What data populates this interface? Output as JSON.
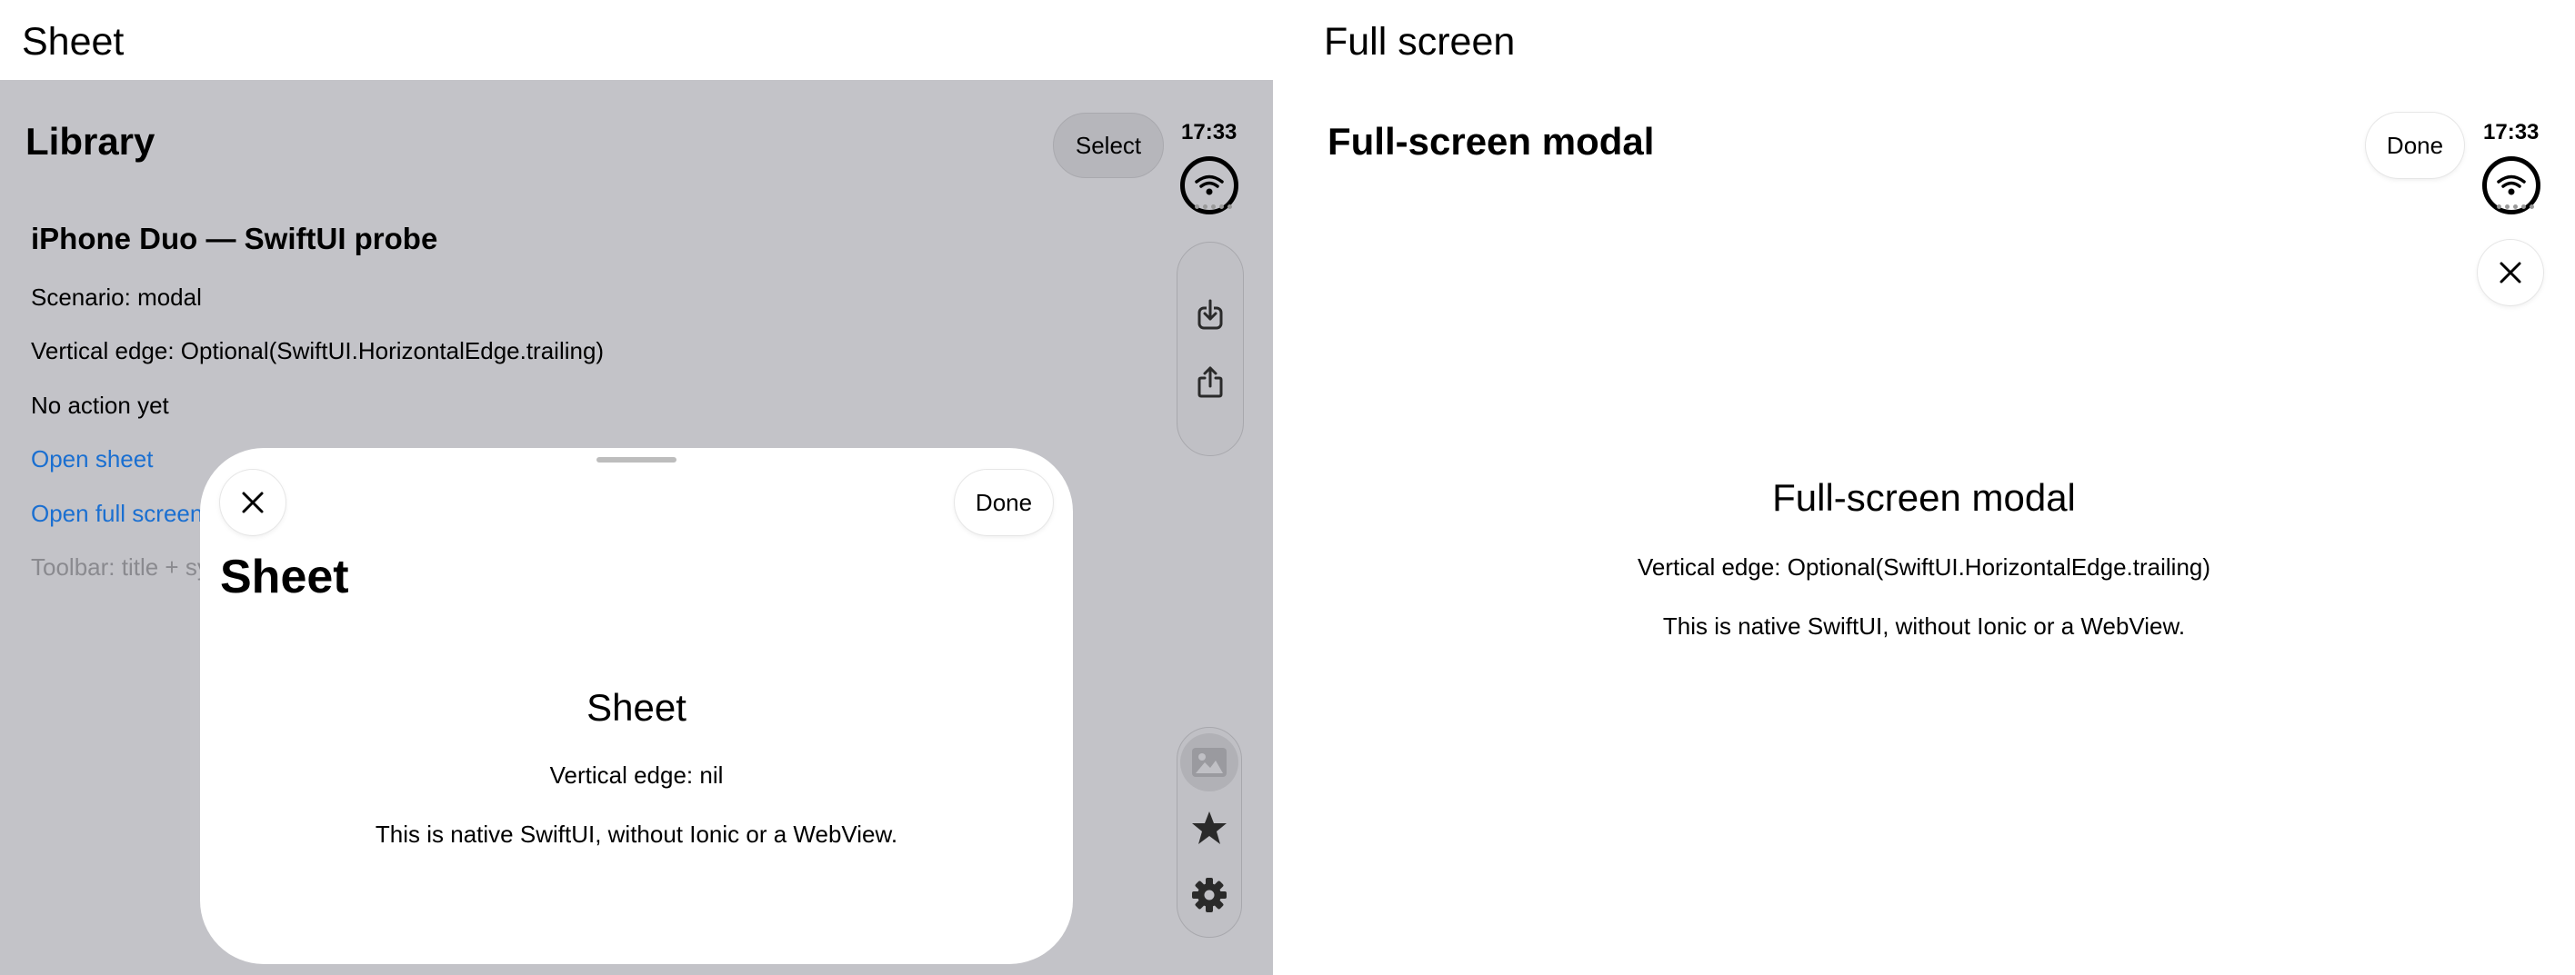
{
  "captions": {
    "left": "Sheet",
    "right": "Full screen"
  },
  "status": {
    "time": "17:33"
  },
  "library": {
    "title": "Library",
    "select_label": "Select",
    "probe": {
      "heading": "iPhone Duo — SwiftUI probe",
      "scenario": "Scenario: modal",
      "vertical_edge": "Vertical edge: Optional(SwiftUI.HorizontalEdge.trailing)",
      "action": "No action yet",
      "open_sheet": "Open sheet",
      "open_full_screen": "Open full screen",
      "toolbar": "Toolbar: title + sy"
    },
    "top_tools": [
      "download-icon",
      "share-icon"
    ],
    "bottom_tools": [
      "photo-icon",
      "star-icon",
      "gear-icon"
    ]
  },
  "sheet": {
    "title": "Sheet",
    "done_label": "Done",
    "body_title": "Sheet",
    "vertical_edge": "Vertical edge: nil",
    "native_note": "This is native SwiftUI, without Ionic or a WebView."
  },
  "fullscreen": {
    "title": "Full-screen modal",
    "done_label": "Done",
    "body_title": "Full-screen modal",
    "vertical_edge": "Vertical edge: Optional(SwiftUI.HorizontalEdge.trailing)",
    "native_note": "This is native SwiftUI, without Ionic or a WebView."
  },
  "colors": {
    "dimmed_background": "#c3c3c8",
    "link": "#1a6fd1",
    "muted": "#8a8a8f"
  }
}
